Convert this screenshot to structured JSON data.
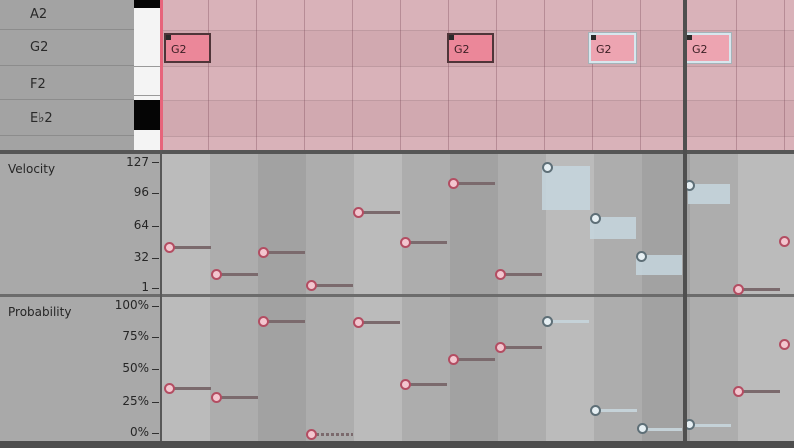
{
  "piano": {
    "keys": [
      {
        "id": "a2",
        "label": "A2"
      },
      {
        "id": "g2",
        "label": "G2"
      },
      {
        "id": "f2",
        "label": "F2"
      },
      {
        "id": "eb2",
        "label": "E♭2"
      }
    ],
    "notes": [
      {
        "label": "G2",
        "state": "selected"
      },
      {
        "label": "G2",
        "state": "selected"
      },
      {
        "label": "G2",
        "state": "unselected"
      },
      {
        "label": "G2",
        "state": "unselected"
      }
    ]
  },
  "velocity": {
    "title": "Velocity",
    "ticks": [
      "127",
      "96",
      "64",
      "32",
      "1"
    ]
  },
  "probability": {
    "title": "Probability",
    "ticks": [
      "100%",
      "75%",
      "50%",
      "25%",
      "0%"
    ]
  },
  "colors": {
    "note_selected": "#eb8799",
    "note_unselected": "#eda4b1",
    "handle_selected": "#b34d62",
    "handle_unselected": "#5e6f77",
    "grid": "#d9b2b9"
  }
}
